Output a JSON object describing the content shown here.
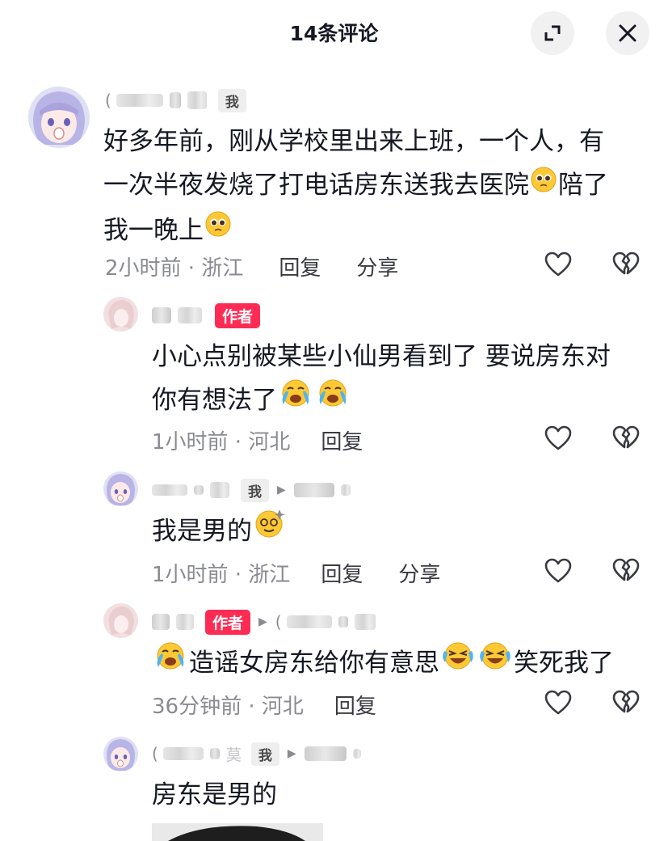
{
  "header": {
    "title": "14条评论"
  },
  "comments": [
    {
      "name_prefix": "(",
      "me_tag": "我",
      "text": [
        "好多年前，刚从学校里出来上班，一个人，有",
        "一次半夜发烧了打电话房东送我去医院",
        "陪了",
        "我一晚上"
      ],
      "time": "2小时前 · 浙江",
      "reply": "回复",
      "share": "分享"
    },
    {
      "author_tag": "作者",
      "text": [
        "小心点别被某些小仙男看到了 要说房东对",
        "你有想法了"
      ],
      "time": "1小时前 · 河北",
      "reply": "回复"
    },
    {
      "me_tag": "我",
      "text": [
        "我是男的"
      ],
      "time": "1小时前 · 浙江",
      "reply": "回复",
      "share": "分享"
    },
    {
      "author_tag": "作者",
      "reply_to_prefix": "(",
      "text": [
        "造谣女房东给你有意思",
        "笑死我了"
      ],
      "time": "36分钟前 · 河北",
      "reply": "回复"
    },
    {
      "name_prefix": "(",
      "name_char": "莫",
      "me_tag": "我",
      "text": [
        "房东是男的"
      ]
    }
  ],
  "icons": {
    "expand": "expand-icon",
    "close": "close-icon",
    "like": "heart-outline-icon",
    "dislike": "broken-heart-icon",
    "reply_arrow": "caret-right-icon"
  },
  "colors": {
    "author_tag": "#fe2c55",
    "meta": "#8a8b91",
    "text": "#161823"
  }
}
